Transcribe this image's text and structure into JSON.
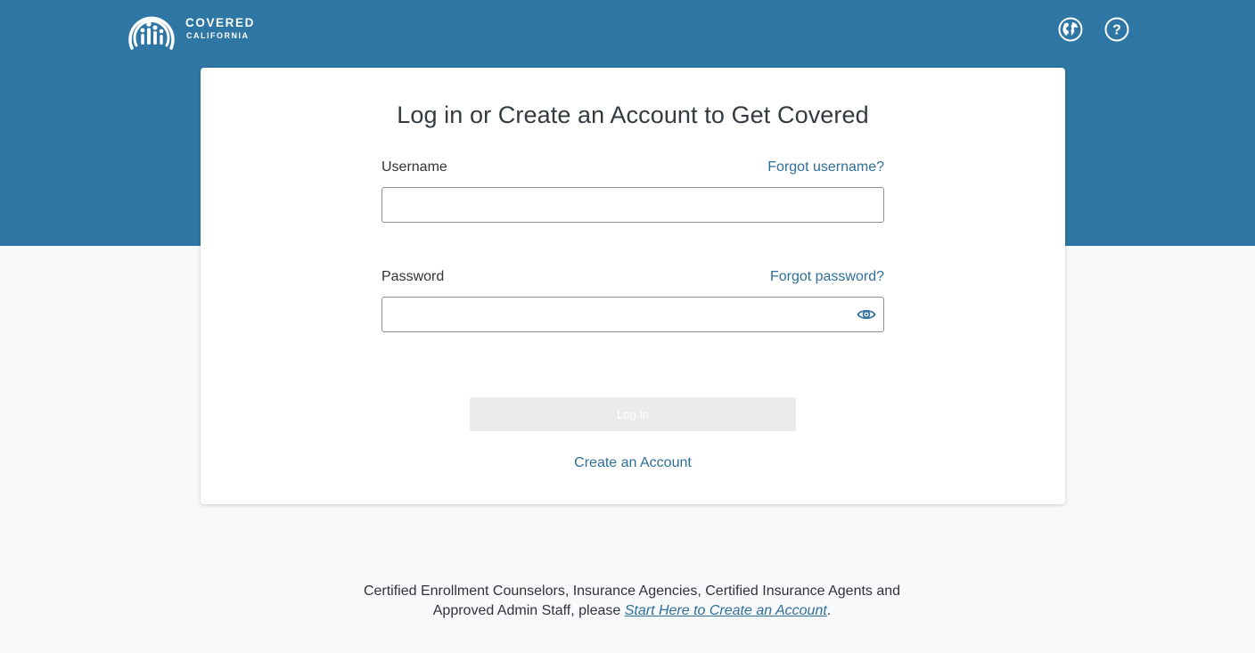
{
  "header": {
    "logo_text": [
      "COVERED",
      "CALIFORNIA"
    ],
    "brand_color": "#2e77a4",
    "icons": [
      "globe-icon",
      "help-icon"
    ]
  },
  "login": {
    "title": "Log in or Create an Account to Get Covered",
    "username_label": "Username",
    "forgot_username": "Forgot username?",
    "username_value": "",
    "password_label": "Password",
    "forgot_password": "Forgot password?",
    "password_value": "",
    "login_button": "Log In",
    "create_account": "Create an Account"
  },
  "footer": {
    "note_text": "Certified Enrollment Counselors, Insurance Agencies, Certified Insurance Agents and Approved Admin Staff, please",
    "link_text": "Start Here to Create an Account",
    "trailing": "."
  },
  "colors": {
    "link": "#2e6f9b",
    "background": "#f8f9fa",
    "button_disabled": "#e9ebec"
  }
}
